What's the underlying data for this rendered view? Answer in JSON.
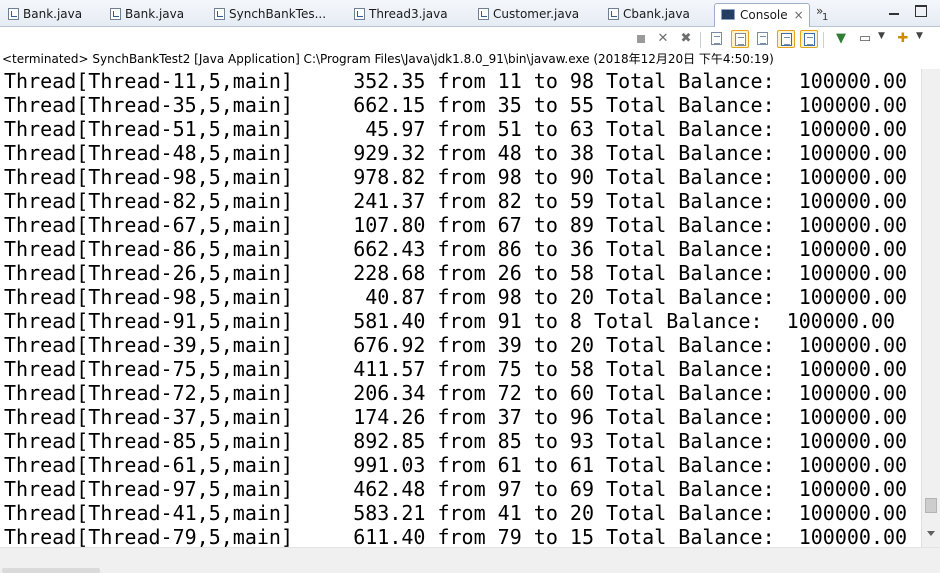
{
  "tabs": [
    {
      "label": "Bank.java",
      "active": false
    },
    {
      "label": "Bank.java",
      "active": false
    },
    {
      "label": "SynchBankTes...",
      "active": false
    },
    {
      "label": "Thread3.java",
      "active": false
    },
    {
      "label": "Customer.java",
      "active": false
    },
    {
      "label": "Cbank.java",
      "active": false
    },
    {
      "label": "Console",
      "active": true
    }
  ],
  "tab_overflow": {
    "chevron": "»",
    "count": "1"
  },
  "close_glyph": "×",
  "toolbar_icons": [
    "terminate-icon",
    "remove-launch-icon",
    "remove-all-terminated-icon",
    "clear-console-icon",
    "scroll-lock-icon",
    "word-wrap-icon",
    "show-on-stdout-icon",
    "show-on-stderr-icon",
    "pin-console-icon",
    "display-selected-console-icon",
    "open-console-icon"
  ],
  "console": {
    "status": "<terminated> SynchBankTest2 [Java Application] C:\\Program Files\\Java\\jdk1.8.0_91\\bin\\javaw.exe (2018年12月20日 下午4:50:19)",
    "lines": [
      "Thread[Thread-11,5,main]     352.35 from 11 to 98 Total Balance:  100000.00",
      "Thread[Thread-35,5,main]     662.15 from 35 to 55 Total Balance:  100000.00",
      "Thread[Thread-51,5,main]      45.97 from 51 to 63 Total Balance:  100000.00",
      "Thread[Thread-48,5,main]     929.32 from 48 to 38 Total Balance:  100000.00",
      "Thread[Thread-98,5,main]     978.82 from 98 to 90 Total Balance:  100000.00",
      "Thread[Thread-82,5,main]     241.37 from 82 to 59 Total Balance:  100000.00",
      "Thread[Thread-67,5,main]     107.80 from 67 to 89 Total Balance:  100000.00",
      "Thread[Thread-86,5,main]     662.43 from 86 to 36 Total Balance:  100000.00",
      "Thread[Thread-26,5,main]     228.68 from 26 to 58 Total Balance:  100000.00",
      "Thread[Thread-98,5,main]      40.87 from 98 to 20 Total Balance:  100000.00",
      "Thread[Thread-91,5,main]     581.40 from 91 to 8 Total Balance:  100000.00",
      "Thread[Thread-39,5,main]     676.92 from 39 to 20 Total Balance:  100000.00",
      "Thread[Thread-75,5,main]     411.57 from 75 to 58 Total Balance:  100000.00",
      "Thread[Thread-72,5,main]     206.34 from 72 to 60 Total Balance:  100000.00",
      "Thread[Thread-37,5,main]     174.26 from 37 to 96 Total Balance:  100000.00",
      "Thread[Thread-85,5,main]     892.85 from 85 to 93 Total Balance:  100000.00",
      "Thread[Thread-61,5,main]     991.03 from 61 to 61 Total Balance:  100000.00",
      "Thread[Thread-97,5,main]     462.48 from 97 to 69 Total Balance:  100000.00",
      "Thread[Thread-41,5,main]     583.21 from 41 to 20 Total Balance:  100000.00",
      "Thread[Thread-79,5,main]     611.40 from 79 to 15 Total Balance:  100000.00"
    ]
  }
}
